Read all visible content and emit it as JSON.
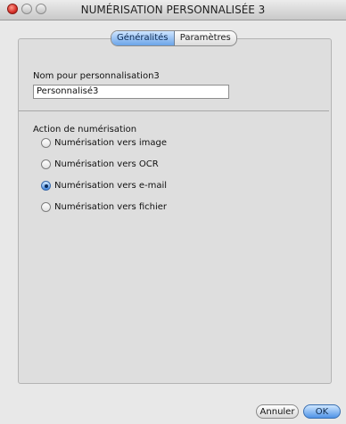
{
  "window": {
    "title": "NUMÉRISATION PERSONNALISÉE 3"
  },
  "tabs": [
    {
      "label": "Généralités",
      "selected": true
    },
    {
      "label": "Paramètres",
      "selected": false
    }
  ],
  "form": {
    "name_label": "Nom pour personnalisation3",
    "name_value": "Personnalisé3",
    "action_label": "Action de numérisation",
    "options": [
      {
        "label": "Numérisation vers image",
        "selected": false
      },
      {
        "label": "Numérisation vers OCR",
        "selected": false
      },
      {
        "label": "Numérisation vers e-mail",
        "selected": true
      },
      {
        "label": "Numérisation vers fichier",
        "selected": false
      }
    ]
  },
  "buttons": {
    "cancel": "Annuler",
    "ok": "OK"
  },
  "colors": {
    "accent": "#4f93e7",
    "close": "#d6302a"
  }
}
